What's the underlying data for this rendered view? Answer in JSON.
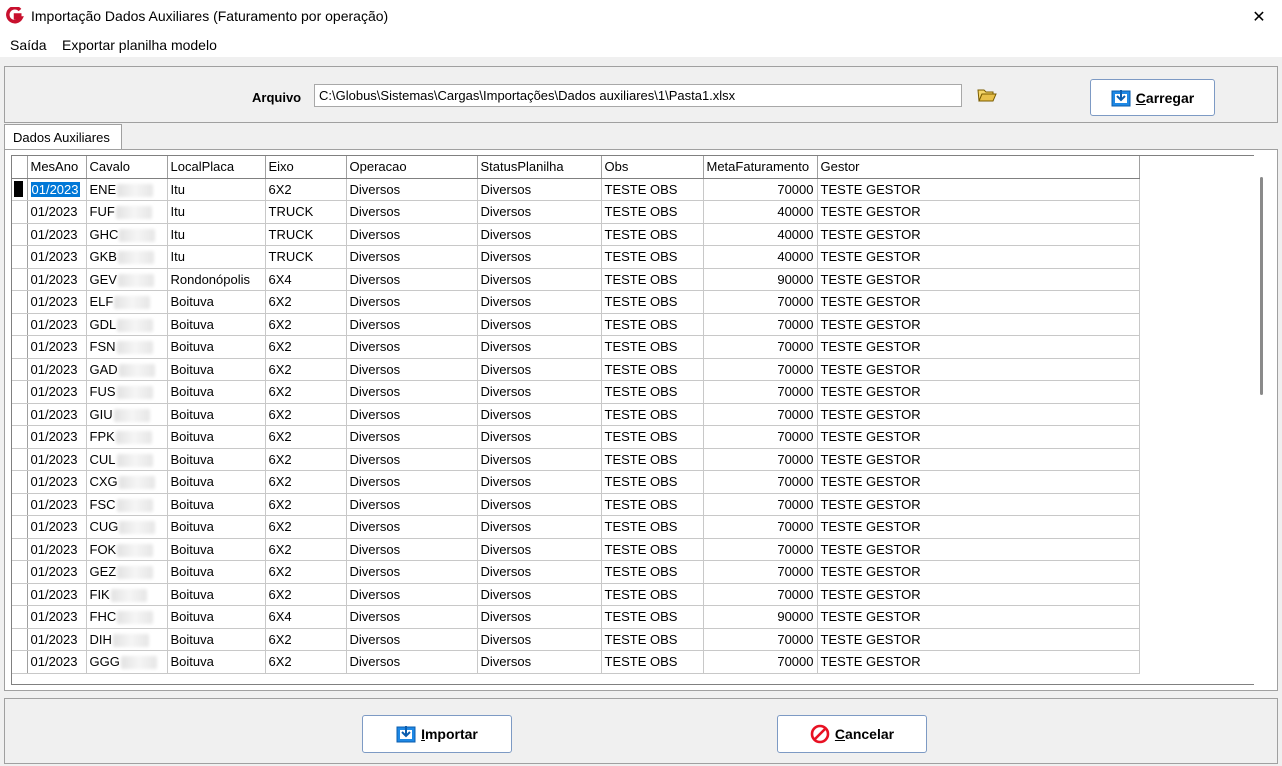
{
  "window": {
    "title": "Importação Dados Auxiliares (Faturamento por operação)",
    "close_glyph": "✕"
  },
  "menu": {
    "items": [
      "Saída",
      "Exportar planilha modelo"
    ]
  },
  "file": {
    "label": "Arquivo",
    "value": "C:\\Globus\\Sistemas\\Cargas\\Importações\\Dados auxiliares\\1\\Pasta1.xlsx"
  },
  "buttons": {
    "load": {
      "accel": "C",
      "rest": "arregar"
    },
    "import": {
      "accel": "I",
      "rest": "mportar"
    },
    "cancel": {
      "accel": "C",
      "rest": "ancelar"
    }
  },
  "tabs": [
    "Dados Auxiliares"
  ],
  "grid": {
    "columns": [
      "MesAno",
      "Cavalo",
      "LocalPlaca",
      "Eixo",
      "Operacao",
      "StatusPlanilha",
      "Obs",
      "MetaFaturamento",
      "Gestor"
    ],
    "rows": [
      [
        "01/2023",
        "ENE",
        "Itu",
        "6X2",
        "Diversos",
        "Diversos",
        "TESTE OBS",
        "70000",
        "TESTE GESTOR"
      ],
      [
        "01/2023",
        "FUF",
        "Itu",
        "TRUCK",
        "Diversos",
        "Diversos",
        "TESTE OBS",
        "40000",
        "TESTE GESTOR"
      ],
      [
        "01/2023",
        "GHC",
        "Itu",
        "TRUCK",
        "Diversos",
        "Diversos",
        "TESTE OBS",
        "40000",
        "TESTE GESTOR"
      ],
      [
        "01/2023",
        "GKB",
        "Itu",
        "TRUCK",
        "Diversos",
        "Diversos",
        "TESTE OBS",
        "40000",
        "TESTE GESTOR"
      ],
      [
        "01/2023",
        "GEV",
        "Rondonópolis",
        "6X4",
        "Diversos",
        "Diversos",
        "TESTE OBS",
        "90000",
        "TESTE GESTOR"
      ],
      [
        "01/2023",
        "ELF",
        "Boituva",
        "6X2",
        "Diversos",
        "Diversos",
        "TESTE OBS",
        "70000",
        "TESTE GESTOR"
      ],
      [
        "01/2023",
        "GDL",
        "Boituva",
        "6X2",
        "Diversos",
        "Diversos",
        "TESTE OBS",
        "70000",
        "TESTE GESTOR"
      ],
      [
        "01/2023",
        "FSN",
        "Boituva",
        "6X2",
        "Diversos",
        "Diversos",
        "TESTE OBS",
        "70000",
        "TESTE GESTOR"
      ],
      [
        "01/2023",
        "GAD",
        "Boituva",
        "6X2",
        "Diversos",
        "Diversos",
        "TESTE OBS",
        "70000",
        "TESTE GESTOR"
      ],
      [
        "01/2023",
        "FUS",
        "Boituva",
        "6X2",
        "Diversos",
        "Diversos",
        "TESTE OBS",
        "70000",
        "TESTE GESTOR"
      ],
      [
        "01/2023",
        "GIU",
        "Boituva",
        "6X2",
        "Diversos",
        "Diversos",
        "TESTE OBS",
        "70000",
        "TESTE GESTOR"
      ],
      [
        "01/2023",
        "FPK",
        "Boituva",
        "6X2",
        "Diversos",
        "Diversos",
        "TESTE OBS",
        "70000",
        "TESTE GESTOR"
      ],
      [
        "01/2023",
        "CUL",
        "Boituva",
        "6X2",
        "Diversos",
        "Diversos",
        "TESTE OBS",
        "70000",
        "TESTE GESTOR"
      ],
      [
        "01/2023",
        "CXG",
        "Boituva",
        "6X2",
        "Diversos",
        "Diversos",
        "TESTE OBS",
        "70000",
        "TESTE GESTOR"
      ],
      [
        "01/2023",
        "FSC",
        "Boituva",
        "6X2",
        "Diversos",
        "Diversos",
        "TESTE OBS",
        "70000",
        "TESTE GESTOR"
      ],
      [
        "01/2023",
        "CUG",
        "Boituva",
        "6X2",
        "Diversos",
        "Diversos",
        "TESTE OBS",
        "70000",
        "TESTE GESTOR"
      ],
      [
        "01/2023",
        "FOK",
        "Boituva",
        "6X2",
        "Diversos",
        "Diversos",
        "TESTE OBS",
        "70000",
        "TESTE GESTOR"
      ],
      [
        "01/2023",
        "GEZ",
        "Boituva",
        "6X2",
        "Diversos",
        "Diversos",
        "TESTE OBS",
        "70000",
        "TESTE GESTOR"
      ],
      [
        "01/2023",
        "FIK",
        "Boituva",
        "6X2",
        "Diversos",
        "Diversos",
        "TESTE OBS",
        "70000",
        "TESTE GESTOR"
      ],
      [
        "01/2023",
        "FHC",
        "Boituva",
        "6X4",
        "Diversos",
        "Diversos",
        "TESTE OBS",
        "90000",
        "TESTE GESTOR"
      ],
      [
        "01/2023",
        "DIH",
        "Boituva",
        "6X2",
        "Diversos",
        "Diversos",
        "TESTE OBS",
        "70000",
        "TESTE GESTOR"
      ],
      [
        "01/2023",
        "GGG",
        "Boituva",
        "6X2",
        "Diversos",
        "Diversos",
        "TESTE OBS",
        "70000",
        "TESTE GESTOR"
      ]
    ]
  },
  "colors": {
    "accent": "#0078d7",
    "brand_red": "#c8102e",
    "cancel_red": "#e81123",
    "folder_yellow": "#e8c04a"
  },
  "icons": [
    "app-logo-icon",
    "close-icon",
    "folder-open-icon",
    "load-icon",
    "import-icon",
    "cancel-icon"
  ]
}
